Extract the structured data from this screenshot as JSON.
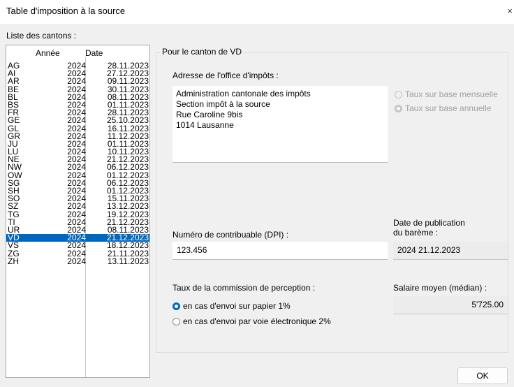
{
  "window": {
    "title": "Table d'imposition à la source",
    "close_glyph": "×"
  },
  "cantons": {
    "label": "Liste des cantons :",
    "col_year": "Année",
    "col_date": "Date",
    "rows": [
      {
        "code": "AG",
        "year": "2024",
        "date": "28.11.2023"
      },
      {
        "code": "AI",
        "year": "2024",
        "date": "27.12.2023"
      },
      {
        "code": "AR",
        "year": "2024",
        "date": "09.11.2023"
      },
      {
        "code": "BE",
        "year": "2024",
        "date": "30.11.2023"
      },
      {
        "code": "BL",
        "year": "2024",
        "date": "08.11.2023"
      },
      {
        "code": "BS",
        "year": "2024",
        "date": "01.11.2023"
      },
      {
        "code": "FR",
        "year": "2024",
        "date": "28.11.2023"
      },
      {
        "code": "GE",
        "year": "2024",
        "date": "25.10.2023"
      },
      {
        "code": "GL",
        "year": "2024",
        "date": "16.11.2023"
      },
      {
        "code": "GR",
        "year": "2024",
        "date": "11.12.2023"
      },
      {
        "code": "JU",
        "year": "2024",
        "date": "01.11.2023"
      },
      {
        "code": "LU",
        "year": "2024",
        "date": "10.11.2023"
      },
      {
        "code": "NE",
        "year": "2024",
        "date": "21.12.2023"
      },
      {
        "code": "NW",
        "year": "2024",
        "date": "06.12.2023"
      },
      {
        "code": "OW",
        "year": "2024",
        "date": "01.12.2023"
      },
      {
        "code": "SG",
        "year": "2024",
        "date": "06.12.2023"
      },
      {
        "code": "SH",
        "year": "2024",
        "date": "01.12.2023"
      },
      {
        "code": "SO",
        "year": "2024",
        "date": "15.11.2023"
      },
      {
        "code": "SZ",
        "year": "2024",
        "date": "13.12.2023"
      },
      {
        "code": "TG",
        "year": "2024",
        "date": "19.12.2023"
      },
      {
        "code": "TI",
        "year": "2024",
        "date": "21.12.2023"
      },
      {
        "code": "UR",
        "year": "2024",
        "date": "08.11.2023"
      },
      {
        "code": "VD",
        "year": "2024",
        "date": "21.12.2023",
        "selected": true
      },
      {
        "code": "VS",
        "year": "2024",
        "date": "18.12.2023"
      },
      {
        "code": "ZG",
        "year": "2024",
        "date": "21.11.2023"
      },
      {
        "code": "ZH",
        "year": "2024",
        "date": "13.11.2023"
      }
    ]
  },
  "details": {
    "group_title": "Pour le canton de VD",
    "address_label": "Adresse de l'office d'impôts :",
    "address_lines": [
      "Administration cantonale des impôts",
      "Section impôt à la source",
      "Rue Caroline 9bis",
      "1014 Lausanne"
    ],
    "rate_monthly": "Taux sur base mensuelle",
    "rate_annual": "Taux sur base annuelle",
    "dpi_label": "Numéro de contribuable (DPI) :",
    "dpi_value": "123.456",
    "pub_label_1": "Date de publication",
    "pub_label_2": "du barème :",
    "pub_value": "2024 21.12.2023",
    "commission_label": "Taux de la commission de perception :",
    "commission_paper": "en cas d'envoi sur papier 1%",
    "commission_electronic": "en cas d'envoi par voie électronique 2%",
    "salary_label": "Salaire moyen (médian) :",
    "salary_value": "5'725.00"
  },
  "buttons": {
    "ok": "OK"
  },
  "colors": {
    "selection": "#0067c0",
    "background": "#f0f0f0"
  }
}
